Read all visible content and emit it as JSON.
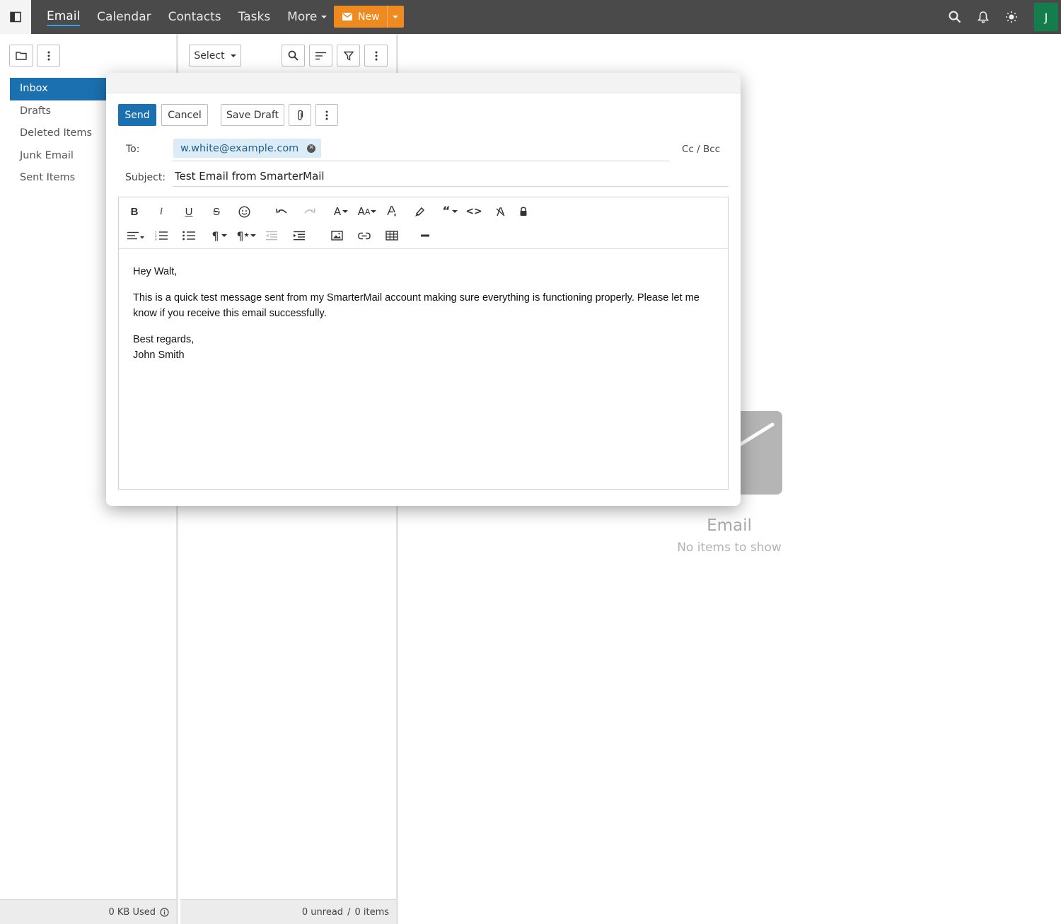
{
  "nav": {
    "items": [
      "Email",
      "Calendar",
      "Contacts",
      "Tasks"
    ],
    "more_label": "More",
    "new_label": "New"
  },
  "user": {
    "avatar_initial": "J"
  },
  "folders_toolbar": {},
  "folders": [
    "Inbox",
    "Drafts",
    "Deleted Items",
    "Junk Email",
    "Sent Items"
  ],
  "list_toolbar": {
    "select_label": "Select"
  },
  "footer": {
    "storage": "0 KB Used",
    "unread": "0 unread",
    "separator": "/",
    "items": "0 items"
  },
  "empty_state": {
    "title": "Email",
    "subtitle": "No items to show"
  },
  "compose": {
    "send_label": "Send",
    "cancel_label": "Cancel",
    "save_draft_label": "Save Draft",
    "to_label": "To:",
    "to_recipient": "w.white@example.com",
    "cc_bcc_label": "Cc / Bcc",
    "subject_label": "Subject:",
    "subject_value": "Test Email from SmarterMail",
    "body": {
      "greeting": "Hey Walt,",
      "paragraph": "This is a quick test message sent from my SmarterMail account making sure everything is functioning properly. Please let me know if you receive this email successfully.",
      "closing": "Best regards,",
      "signature": "John Smith"
    }
  },
  "colors": {
    "topbar": "#4a4a4a",
    "accent_blue": "#1b71b0",
    "new_button": "#ef8a1e",
    "avatar": "#147d4c"
  }
}
